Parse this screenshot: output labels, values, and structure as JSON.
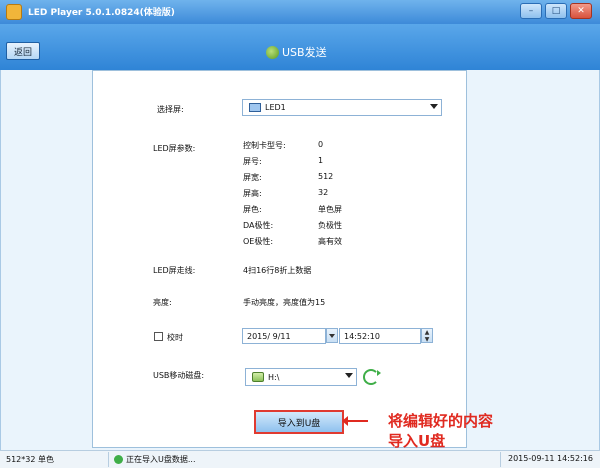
{
  "window": {
    "title": "LED Player 5.0.1.0824(体验版)",
    "buttons": [
      "–",
      "□",
      "✕"
    ]
  },
  "header": {
    "back_label": "返回",
    "page_title": "USB发送"
  },
  "form": {
    "screen_label": "选择屏:",
    "screen_value": "LED1",
    "params_label": "LED屏参数:",
    "params": [
      {
        "name": "控制卡型号:",
        "value": "0"
      },
      {
        "name": "屏号:",
        "value": "1"
      },
      {
        "name": "屏宽:",
        "value": "512"
      },
      {
        "name": "屏高:",
        "value": "32"
      },
      {
        "name": "屏色:",
        "value": "单色屏"
      },
      {
        "name": "DA极性:",
        "value": "负极性"
      },
      {
        "name": "OE极性:",
        "value": "高有效"
      }
    ],
    "scan_label": "LED屏走线:",
    "scan_value": "4扫16行8折上数据",
    "brightness_label": "亮度:",
    "brightness_value": "手动亮度，亮度值为15",
    "timing_label": "校时",
    "date_value": "2015/ 9/11",
    "time_value": "14:52:10",
    "usb_label": "USB移动磁盘:",
    "usb_value": "H:\\",
    "import_button": "导入到U盘"
  },
  "annotation": {
    "line1": "将编辑好的内容",
    "line2": "导入U盘"
  },
  "status": {
    "size": "512*32 单色",
    "message": "正在导入U盘数据...",
    "datetime": "2015-09-11 14:52:16"
  }
}
